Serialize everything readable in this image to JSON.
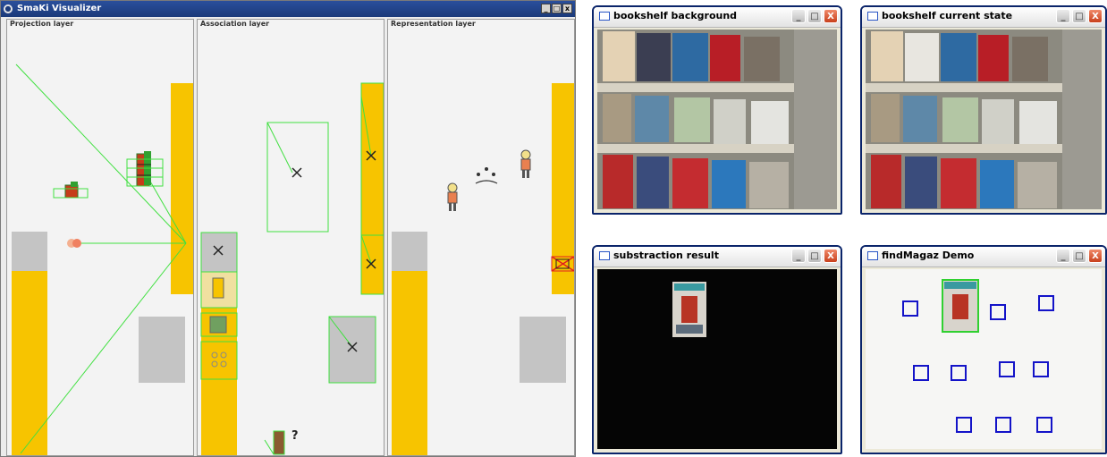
{
  "visualizer": {
    "title": "SmaKi Visualizer",
    "controls": [
      "_",
      "□",
      "x"
    ],
    "panels": [
      {
        "label": "Projection layer"
      },
      {
        "label": "Association layer"
      },
      {
        "label": "Representation layer"
      }
    ],
    "unknown_marker": "?"
  },
  "cameras": [
    {
      "title": "bookshelf background"
    },
    {
      "title": "bookshelf current state"
    },
    {
      "title": "substraction result"
    },
    {
      "title": "findMagaz Demo"
    }
  ],
  "window_controls": {
    "minimize": "_",
    "maximize": "□",
    "close": "X"
  },
  "colors": {
    "shelf": "#f7c400",
    "gray_block": "#c4c4c4",
    "green_line": "#40e040",
    "marker_blue": "#1313c8",
    "titlebar_blue": "#1b3a7a"
  }
}
